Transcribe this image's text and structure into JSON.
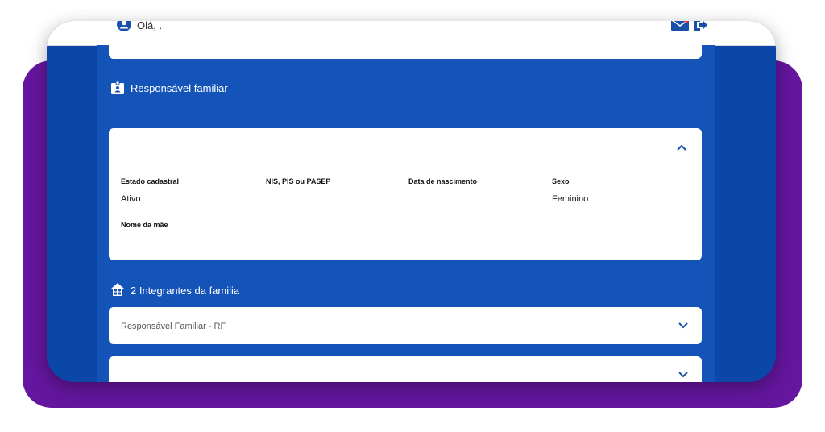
{
  "header": {
    "greeting": "Olá, .",
    "icons": {
      "user": "user-circle-icon",
      "mail": "mail-icon",
      "logout": "logout-icon"
    }
  },
  "responsavel_section": {
    "title": "Responsável familiar",
    "icon": "id-badge-icon",
    "fields": {
      "estado_label": "Estado cadastral",
      "estado_value": "Ativo",
      "nis_label": "NIS, PIS ou PASEP",
      "nascimento_label": "Data de nascimento",
      "sexo_label": "Sexo",
      "sexo_value": "Feminino",
      "mae_label": "Nome da mãe"
    }
  },
  "integrantes_section": {
    "title": "2 Integrantes da familia",
    "icon": "house-people-icon",
    "rows": [
      {
        "label": "Responsável Familiar - RF"
      }
    ]
  },
  "colors": {
    "purple": "#64169e",
    "frame_blue": "#0b47a8",
    "content_blue": "#1453b8",
    "accent_blue": "#1a4fa8"
  }
}
